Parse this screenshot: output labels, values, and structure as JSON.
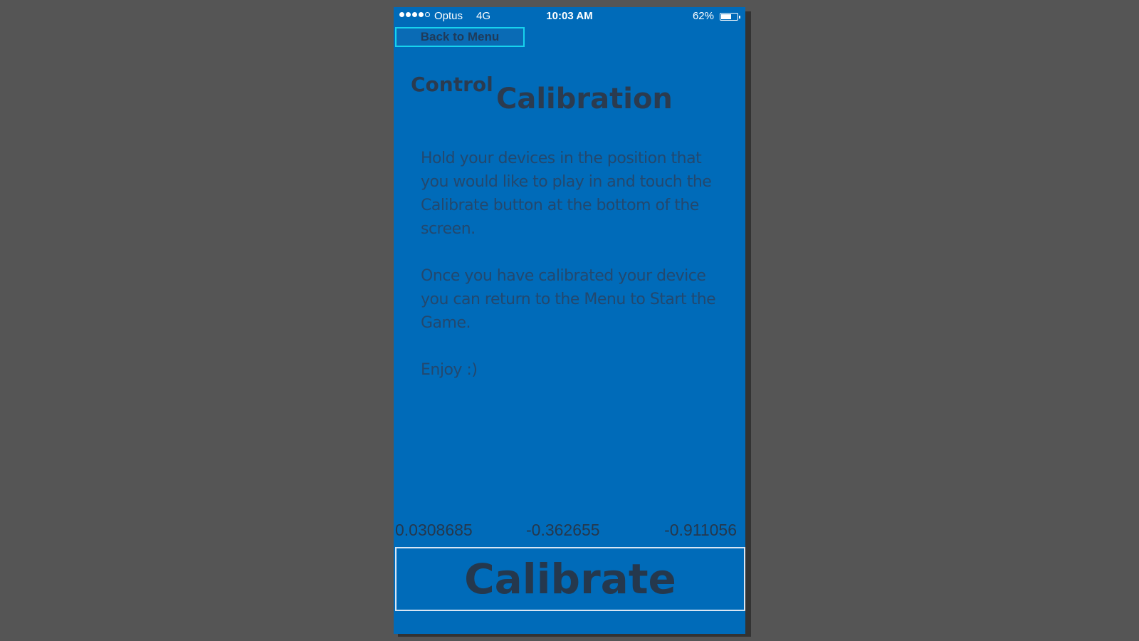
{
  "status_bar": {
    "signal_bars_filled": 4,
    "signal_bars_total": 5,
    "carrier": "Optus",
    "network": "4G",
    "time": "10:03 AM",
    "battery_percent": "62%",
    "battery_level": 0.62
  },
  "nav": {
    "back_label": "Back to Menu"
  },
  "title": {
    "small": "Control",
    "large": "Calibration"
  },
  "instructions": [
    "Hold your devices in the position that you would like to play in and touch the Calibrate button at the bottom of the screen.",
    "Once you have calibrated your device you can return to the Menu to Start the Game.",
    "Enjoy :)"
  ],
  "sensor": {
    "x": "0.0308685",
    "y": "-0.362655",
    "z": "-0.911056"
  },
  "calibrate_label": "Calibrate",
  "colors": {
    "background": "#555555",
    "screen": "#006bb9",
    "button_border_back": "#17d3ee",
    "text_dark": "#2b3b4f"
  }
}
